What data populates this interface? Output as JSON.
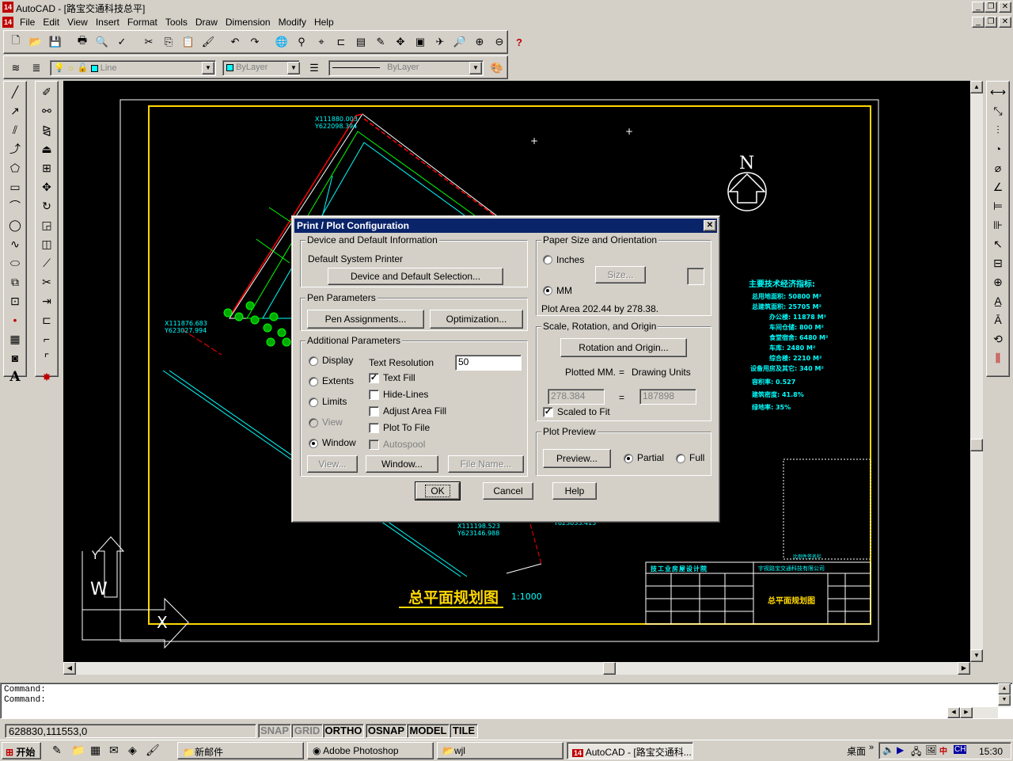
{
  "window": {
    "title": "AutoCAD - [路宝交通科技总平]",
    "icon_label": "14"
  },
  "menu": [
    "File",
    "Edit",
    "View",
    "Insert",
    "Format",
    "Tools",
    "Draw",
    "Dimension",
    "Modify",
    "Help"
  ],
  "toolbar": {
    "linetype_combo": "Line",
    "color_combo": "ByLayer",
    "lineweight_combo": "ByLayer"
  },
  "drawing": {
    "title_text": "总平面规划图",
    "scale_text": "1:1000",
    "north_label": "N",
    "coord1_x": "X111880.003",
    "coord1_y": "Y622098.394",
    "coord2_x": "X111876.683",
    "coord2_y": "Y623027.994",
    "coord3_x": "X111198.523",
    "coord3_y": "Y623146.988",
    "coord4": "Y623033.413",
    "ucs_y": "Y",
    "ucs_w": "W",
    "ucs_x": "X",
    "tech_title": "主要技术经济指标:",
    "tech_items": [
      "总用地面积: 50800 M²",
      "总建筑面积: 25705 M²",
      "办公楼: 11878 M²",
      "车间仓储: 800 M²",
      "食堂宿舍: 6480 M²",
      "车库: 2480 M²",
      "综合楼: 2210 M²",
      "设备用房及其它: 340 M²",
      "容积率: 0.527",
      "建筑密度: 41.8%",
      "绿地率: 35%"
    ],
    "titleblock_company": "技工业房屋设计院",
    "titleblock_project": "宇视路宝交通科技有限公司",
    "titleblock_drawing": "总平面规划图",
    "titleblock_small": "比例件签名栏"
  },
  "dialog": {
    "title": "Print / Plot Configuration",
    "device_group": "Device and Default Information",
    "device_name": "Default System Printer",
    "device_button": "Device and Default Selection...",
    "pen_group": "Pen Parameters",
    "pen_assign_button": "Pen Assignments...",
    "optimization_button": "Optimization...",
    "additional_group": "Additional Parameters",
    "radio_display": "Display",
    "radio_extents": "Extents",
    "radio_limits": "Limits",
    "radio_view": "View",
    "radio_window": "Window",
    "text_resolution_label": "Text Resolution",
    "text_resolution_value": "50",
    "check_text_fill": "Text Fill",
    "check_hide_lines": "Hide-Lines",
    "check_adjust_area_fill": "Adjust Area Fill",
    "check_plot_to_file": "Plot To File",
    "check_autospool": "Autospool",
    "view_button": "View...",
    "window_button": "Window...",
    "file_name_button": "File Name...",
    "paper_group": "Paper Size and Orientation",
    "radio_inches": "Inches",
    "radio_mm": "MM",
    "size_button": "Size...",
    "plot_area_text": "Plot Area 202.44 by 278.38.",
    "scale_group": "Scale, Rotation, and Origin",
    "rotation_button": "Rotation and Origin...",
    "plotted_mm_label": "Plotted MM.",
    "equals": "=",
    "drawing_units_label": "Drawing Units",
    "plotted_mm_value": "278.384",
    "drawing_units_value": "187898",
    "check_scaled_to_fit": "Scaled to Fit",
    "preview_group": "Plot Preview",
    "preview_button": "Preview...",
    "radio_partial": "Partial",
    "radio_full": "Full",
    "ok_button": "OK",
    "cancel_button": "Cancel",
    "help_button": "Help"
  },
  "command": {
    "line1": "Command:",
    "line2": "Command:"
  },
  "status": {
    "coords": "628830,111553,0",
    "snap": "SNAP",
    "grid": "GRID",
    "ortho": "ORTHO",
    "osnap": "OSNAP",
    "model": "MODEL",
    "tile": "TILE"
  },
  "taskbar": {
    "start": "开始",
    "task1": "新邮件",
    "task2": "Adobe Photoshop",
    "task3": "wjl",
    "task4": "AutoCAD - [路宝交通科...",
    "desktop": "桌面",
    "clock": "15:30",
    "lang": "CH"
  },
  "colors": {
    "dialog_title_bg": "#0a246a",
    "cad_bg": "#000000",
    "cad_cyan": "#00ffff",
    "cad_yellow": "#ffd700",
    "cad_red": "#ff0000",
    "cad_green": "#00ff00"
  }
}
